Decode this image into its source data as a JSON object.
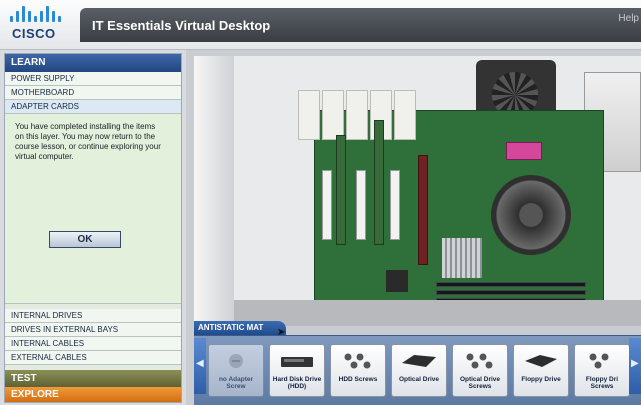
{
  "header": {
    "logo_text": "CISCO",
    "title": "IT Essentials Virtual Desktop",
    "help_label": "Help"
  },
  "sidebar": {
    "learn_label": "LEARN",
    "top_items": [
      {
        "label": "POWER SUPPLY"
      },
      {
        "label": "MOTHERBOARD"
      },
      {
        "label": "ADAPTER CARDS"
      }
    ],
    "message": "You have completed installing the items on this layer. You may now return to the course lesson, or continue exploring your virtual computer.",
    "ok_label": "OK",
    "bottom_items": [
      {
        "label": "INTERNAL DRIVES"
      },
      {
        "label": "DRIVES IN EXTERNAL BAYS"
      },
      {
        "label": "INTERNAL CABLES"
      },
      {
        "label": "EXTERNAL CABLES"
      }
    ],
    "test_label": "TEST",
    "explore_label": "EXPLORE"
  },
  "mat": {
    "tab_label": "ANTISTATIC MAT",
    "parts": [
      {
        "label": "no Adapter Screw"
      },
      {
        "label": "Hard Disk Drive (HDD)"
      },
      {
        "label": "HDD Screws"
      },
      {
        "label": "Optical Drive"
      },
      {
        "label": "Optical Drive Screws"
      },
      {
        "label": "Floppy Drive"
      },
      {
        "label": "Floppy Dri Screws"
      }
    ]
  },
  "colors": {
    "learn_bar": "#23467f",
    "test_bar": "#5e6233",
    "explore_bar": "#d26e10",
    "motherboard": "#2f6f39"
  }
}
